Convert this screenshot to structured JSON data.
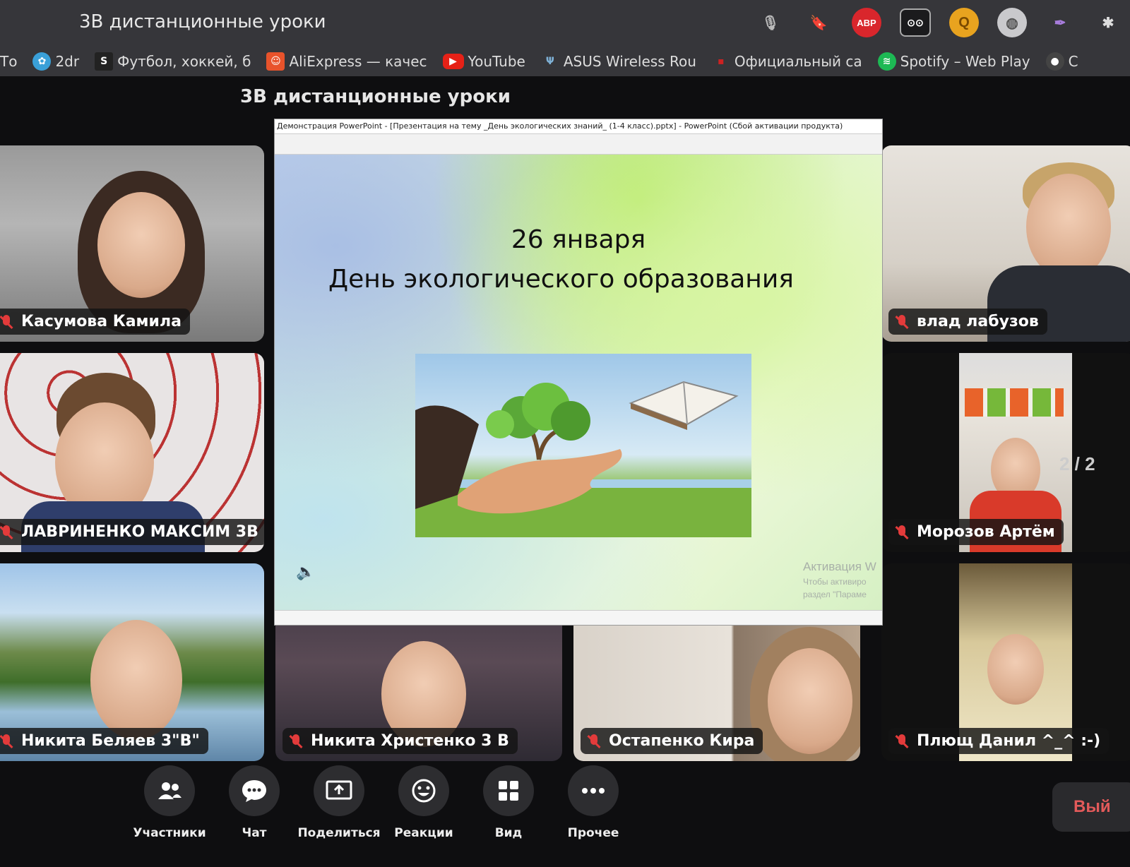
{
  "browser": {
    "tab_title": "3В дистанционные уроки",
    "extensions": [
      {
        "icon": "mic-icon",
        "label": ""
      },
      {
        "icon": "bookmark-icon",
        "label": ""
      },
      {
        "icon": "adblock-plus-icon",
        "label": "ABP"
      },
      {
        "icon": "camera-extension-icon",
        "label": ""
      },
      {
        "icon": "coin-extension-icon",
        "label": ""
      },
      {
        "icon": "globe-icon",
        "label": ""
      },
      {
        "icon": "feather-icon",
        "label": ""
      },
      {
        "icon": "puzzle-icon",
        "label": ""
      }
    ],
    "bookmarks": [
      {
        "label": "То",
        "icon": "folder-icon"
      },
      {
        "label": "2dr",
        "icon": "flower-icon"
      },
      {
        "label": "Футбол, хоккей, б",
        "icon": "sports-s-icon"
      },
      {
        "label": "AliExpress — качес",
        "icon": "aliexpress-icon"
      },
      {
        "label": "YouTube",
        "icon": "youtube-icon"
      },
      {
        "label": "ASUS Wireless Rou",
        "icon": "asus-icon"
      },
      {
        "label": "Официальный са",
        "icon": "flag-icon"
      },
      {
        "label": "Spotify – Web Play",
        "icon": "spotify-icon"
      },
      {
        "label": "С",
        "icon": "folder-icon"
      }
    ]
  },
  "meeting": {
    "title": "3В дистанционные уроки",
    "page_indicator": "2 / 2"
  },
  "participants": [
    {
      "name": "Касумова Камила"
    },
    {
      "name": "ЛАВРИНЕНКО МАКСИМ 3В"
    },
    {
      "name": "Никита Беляев 3\"В\""
    },
    {
      "name": "Никита Христенко 3 В"
    },
    {
      "name": "Остапенко Кира"
    },
    {
      "name": "Плющ Данил ^_^ :-)"
    },
    {
      "name": "Морозов Артём"
    },
    {
      "name": "влад лабузов"
    }
  ],
  "presentation": {
    "window_title": "Демонстрация PowerPoint - [Презентация на тему _День экологических знаний_ (1-4 класс).pptx] - PowerPoint (Сбой активации продукта)",
    "slide_line1": "26 января",
    "slide_line2": "День экологического образования",
    "watermark_title": "Активация W",
    "watermark_line1": "Чтобы активиро",
    "watermark_line2": "раздел \"Параме"
  },
  "toolbar": {
    "items": [
      {
        "label": "Участники",
        "icon": "participants-icon"
      },
      {
        "label": "Чат",
        "icon": "chat-icon"
      },
      {
        "label": "Поделиться",
        "icon": "share-screen-icon"
      },
      {
        "label": "Реакции",
        "icon": "reactions-icon"
      },
      {
        "label": "Вид",
        "icon": "view-grid-icon"
      },
      {
        "label": "Прочее",
        "icon": "more-icon"
      }
    ],
    "leave_label": "Вый"
  }
}
